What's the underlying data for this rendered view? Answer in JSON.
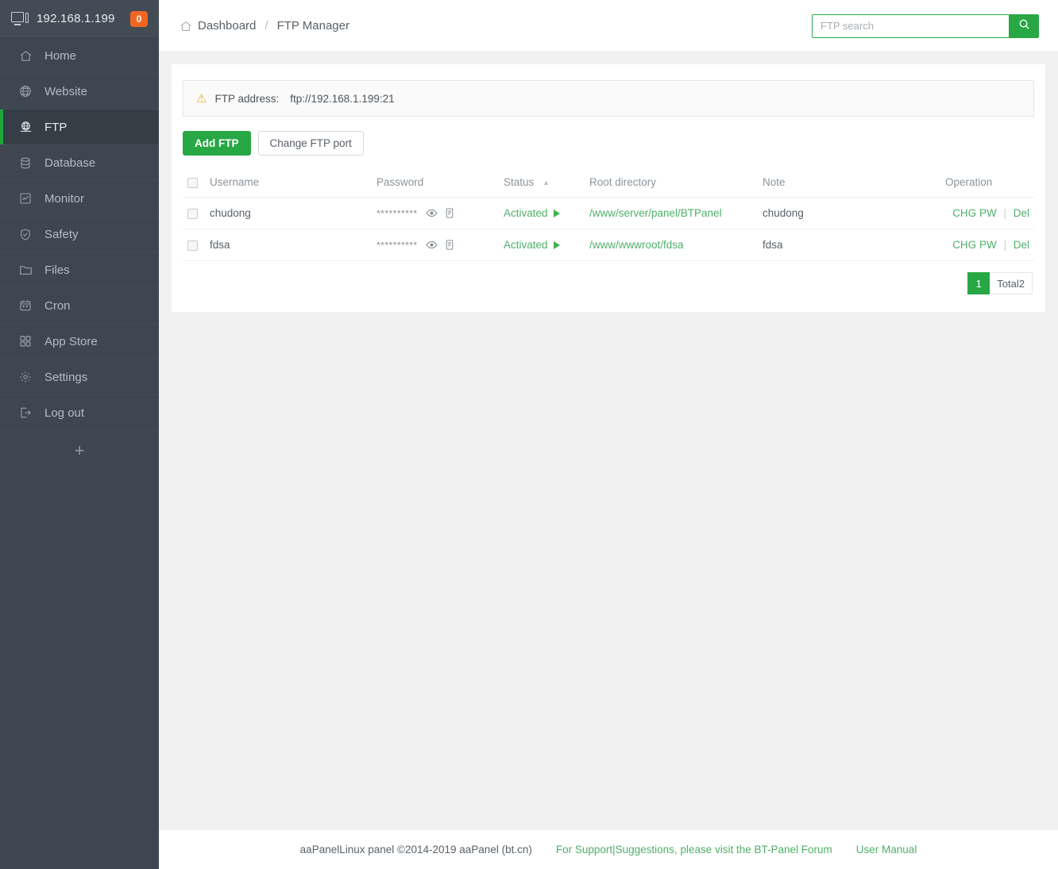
{
  "sidebar": {
    "host": "192.168.1.199",
    "badge": "0",
    "items": [
      {
        "label": "Home",
        "icon": "home-icon"
      },
      {
        "label": "Website",
        "icon": "globe-icon"
      },
      {
        "label": "FTP",
        "icon": "ftp-globe-icon"
      },
      {
        "label": "Database",
        "icon": "database-icon"
      },
      {
        "label": "Monitor",
        "icon": "monitor-chart-icon"
      },
      {
        "label": "Safety",
        "icon": "shield-check-icon"
      },
      {
        "label": "Files",
        "icon": "folder-icon"
      },
      {
        "label": "Cron",
        "icon": "calendar-icon"
      },
      {
        "label": "App Store",
        "icon": "grid-apps-icon"
      },
      {
        "label": "Settings",
        "icon": "gear-icon"
      },
      {
        "label": "Log out",
        "icon": "logout-icon"
      }
    ],
    "active_index": 2,
    "add_label": "+"
  },
  "topbar": {
    "breadcrumb_root": "Dashboard",
    "breadcrumb_sep": "/",
    "breadcrumb_current": "FTP Manager",
    "search_value": "",
    "search_placeholder": "FTP search"
  },
  "notice": {
    "label": "FTP address:",
    "value": "ftp://192.168.1.199:21"
  },
  "toolbar": {
    "add_label": "Add FTP",
    "change_port_label": "Change FTP port"
  },
  "table": {
    "headers": {
      "username": "Username",
      "password": "Password",
      "status": "Status",
      "root": "Root directory",
      "note": "Note",
      "operation": "Operation"
    },
    "sort_column": "Status",
    "sort_direction": "asc",
    "rows": [
      {
        "username": "chudong",
        "password_mask": "**********",
        "status": "Activated",
        "root": "/www/server/panel/BTPanel",
        "note": "chudong",
        "op_chg": "CHG PW",
        "op_sep": "|",
        "op_del": "Del"
      },
      {
        "username": "fdsa",
        "password_mask": "**********",
        "status": "Activated",
        "root": "/www/wwwroot/fdsa",
        "note": "fdsa",
        "op_chg": "CHG PW",
        "op_sep": "|",
        "op_del": "Del"
      }
    ]
  },
  "pagination": {
    "current_page": "1",
    "total_label": "Total2"
  },
  "footer": {
    "copyright": "aaPanelLinux panel ©2014-2019 aaPanel (bt.cn)",
    "support_link": "For Support|Suggestions, please visit the BT-Panel Forum",
    "manual_link": "User Manual"
  },
  "colors": {
    "brand_green": "#28a745",
    "link_green": "#4fb06a",
    "sidebar_bg": "#3e4750",
    "sidebar_active_bg": "#353d45",
    "badge_orange": "#f26522",
    "warn_amber": "#f0ad27"
  }
}
